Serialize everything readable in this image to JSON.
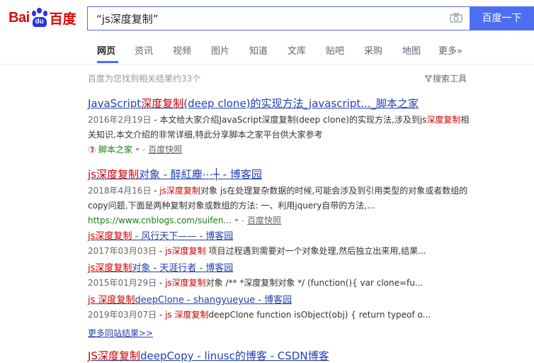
{
  "header": {
    "logo_bai": "Bai",
    "logo_du": "du",
    "logo_cn": "百度",
    "search_value": "“js深度复制”",
    "search_button": "百度一下"
  },
  "nav": {
    "items": [
      "网页",
      "资讯",
      "视频",
      "图片",
      "知道",
      "文库",
      "贴吧",
      "采购",
      "地图",
      "更多»"
    ]
  },
  "stats": {
    "count": "百度为您找到相关结果约33个",
    "tools": "搜索工具"
  },
  "results": [
    {
      "title_pre": "JavaScript",
      "title_em": "深度复制",
      "title_post": "(deep clone)的实现方法_javascript..._脚本之家",
      "date": "2016年2月19日",
      "abs_pre": " - 本文给大家介绍JavaScript深度复制(deep clone)的实现方法,涉及到js",
      "abs_em": "深度复制",
      "abs_post": "相关知识,本文介绍的非常详细,特此分享脚本之家平台供大家参考",
      "source": "脚本之家",
      "kuaizhao": "百度快照"
    },
    {
      "title_em": "js深度复制",
      "title_post": "对象 - 醉紅塵⋯┼ - 博客园",
      "date": "2018年4月16日",
      "abs_pre": " - ",
      "abs_em": "js深度复制",
      "abs_post": "对象 js在处理复杂数据的时候,可能会涉及到引用类型的对象或者数组的copy问题,下面是两种复制对象或数组的方法: 一、利用jquery自带的方法,...",
      "source": "https://www.cnblogs.com/suifen...",
      "kuaizhao": "百度快照"
    }
  ],
  "subresults": [
    {
      "title_em": "js深度复制",
      "title_post": " - 风行天下—— - 博客园",
      "date": "2017年03月03日",
      "abs_pre": " - ",
      "abs_em": "js深度复制",
      "abs_post": " 项目过程遇到需要对一个对象处理,然后独立出来用,结果..."
    },
    {
      "title_em": "js深度复制",
      "title_post": "对象 - 天涯行者 - 博客园",
      "date": "2015年01月29日",
      "abs_pre": " - ",
      "abs_em": "js深度复制",
      "abs_post": "对象 /** *深度复制对象 */ (function(){ var clone=fu..."
    },
    {
      "title_em": "js 深度复制",
      "title_post": "deepClone - shangyueyue - 博客园",
      "date": "2019年03月07日",
      "abs_pre": " - ",
      "abs_em": "js 深度复制",
      "abs_post": "deepClone function isObject(obj) { return typeof o..."
    }
  ],
  "more_link": "更多同站结果>>",
  "last_result": {
    "title_em": "JS深度复制",
    "title_post": "deepCopy - linusc的博客 - CSDN博客"
  },
  "colors": {
    "brand_blue": "#4e6ef2",
    "link_blue": "#2440b3",
    "highlight_red": "#c00",
    "source_green": "#1a7e15"
  }
}
